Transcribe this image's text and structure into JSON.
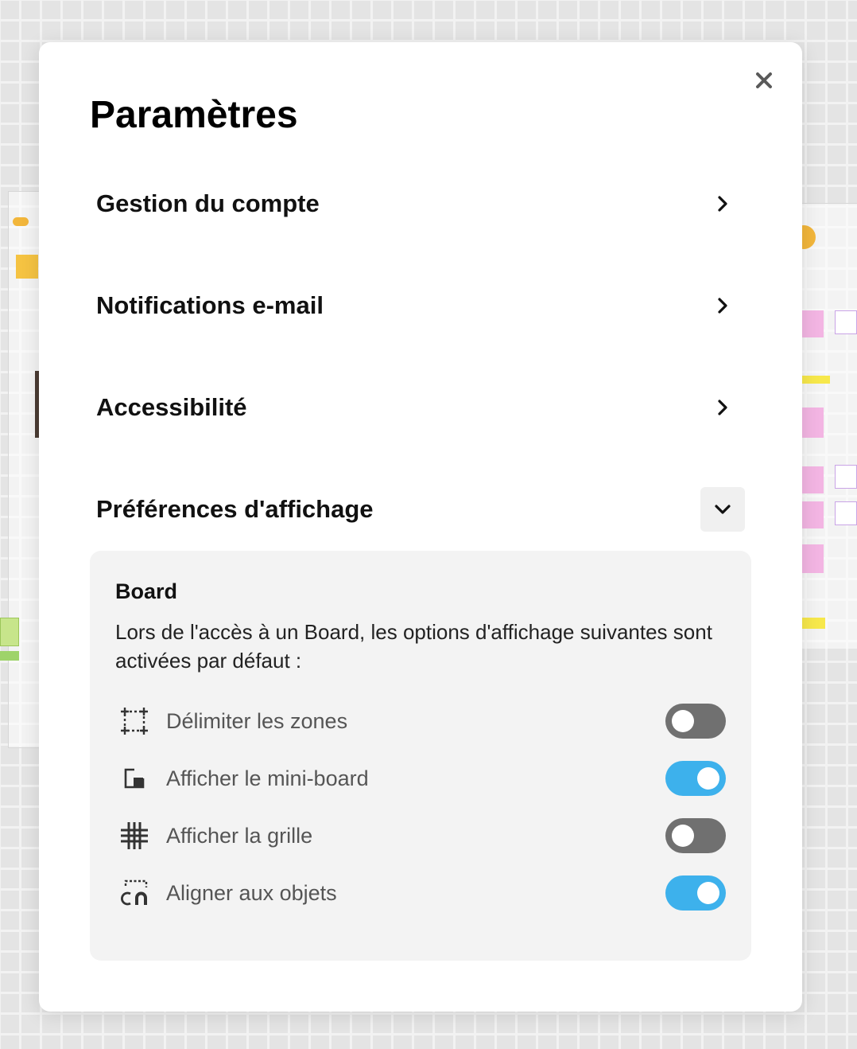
{
  "modal": {
    "title": "Paramètres",
    "close_icon": "close-icon"
  },
  "menu": [
    {
      "label": "Gestion du compte",
      "icon": "chevron-right-icon"
    },
    {
      "label": "Notifications e-mail",
      "icon": "chevron-right-icon"
    },
    {
      "label": "Accessibilité",
      "icon": "chevron-right-icon"
    },
    {
      "label": "Préférences d'affichage",
      "icon": "chevron-down-icon",
      "expanded": true
    }
  ],
  "display_prefs": {
    "section_title": "Board",
    "description": "Lors de l'accès à un Board, les options d'affichage suivantes sont activées par défaut :",
    "options": [
      {
        "label": "Délimiter les zones",
        "icon": "zone-frame-icon",
        "enabled": false
      },
      {
        "label": "Afficher le mini-board",
        "icon": "mini-board-icon",
        "enabled": true
      },
      {
        "label": "Afficher la grille",
        "icon": "grid-icon",
        "enabled": false
      },
      {
        "label": "Aligner aux objets",
        "icon": "snap-magnet-icon",
        "enabled": true
      }
    ]
  },
  "colors": {
    "toggle_on": "#3db1ec",
    "toggle_off": "#707070",
    "panel_bg": "#f3f3f3"
  }
}
